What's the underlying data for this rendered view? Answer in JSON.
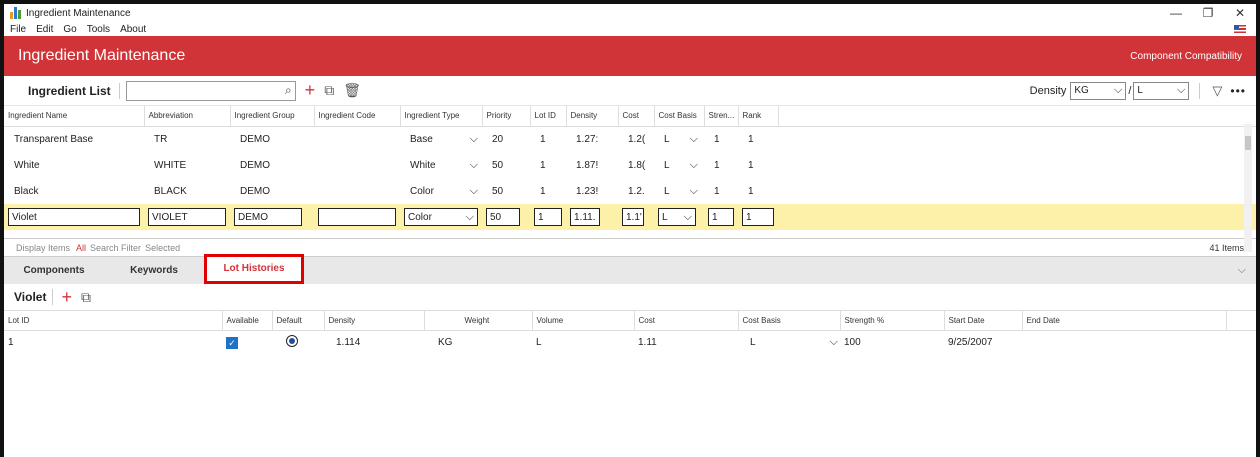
{
  "window": {
    "title": "Ingredient Maintenance",
    "controls": [
      "—",
      "❐",
      "✕"
    ]
  },
  "menu": [
    "File",
    "Edit",
    "Go",
    "Tools",
    "About"
  ],
  "banner": {
    "title": "Ingredient Maintenance",
    "link": "Component Compatibility",
    "color": "#d13438"
  },
  "toolbar": {
    "title": "Ingredient List",
    "search_value": "",
    "density_label": "Density",
    "density_unit1": "KG",
    "density_separator": "/",
    "density_unit2": "L"
  },
  "grid": {
    "columns": [
      "Ingredient Name",
      "Abbreviation",
      "Ingredient Group",
      "Ingredient Code",
      "Ingredient Type",
      "Priority",
      "Lot ID",
      "Density",
      "Cost",
      "Cost Basis",
      "Stren...",
      "Rank"
    ],
    "rows": [
      {
        "name": "Transparent Base",
        "abbr": "TR",
        "group": "DEMO",
        "code": "",
        "type": "Base",
        "priority": "20",
        "lot": "1",
        "density": "1.27:",
        "cost": "1.2(",
        "basis": "L",
        "strength": "1",
        "rank": "1"
      },
      {
        "name": "White",
        "abbr": "WHITE",
        "group": "DEMO",
        "code": "",
        "type": "White",
        "priority": "50",
        "lot": "1",
        "density": "1.87!",
        "cost": "1.8(",
        "basis": "L",
        "strength": "1",
        "rank": "1"
      },
      {
        "name": "Black",
        "abbr": "BLACK",
        "group": "DEMO",
        "code": "",
        "type": "Color",
        "priority": "50",
        "lot": "1",
        "density": "1.23!",
        "cost": "1.2.",
        "basis": "L",
        "strength": "1",
        "rank": "1"
      }
    ],
    "selected": {
      "name": "Violet",
      "abbr": "VIOLET",
      "group": "DEMO",
      "code": "",
      "type": "Color",
      "priority": "50",
      "lot": "1",
      "density": "1.11.",
      "cost": "1.1'",
      "basis": "L",
      "strength": "1",
      "rank": "1"
    }
  },
  "status": {
    "display_items": "Display Items",
    "all": "All",
    "search_filter": "Search Filter",
    "selected": "Selected",
    "count": "41 Items"
  },
  "tabs": [
    "Components",
    "Keywords",
    "Lot Histories"
  ],
  "active_tab": "Lot Histories",
  "lot_panel": {
    "title": "Violet",
    "columns": [
      "Lot ID",
      "Available",
      "Default",
      "Density",
      "Weight",
      "Volume",
      "Cost",
      "Cost Basis",
      "Strength %",
      "Start Date",
      "End Date"
    ],
    "rows": [
      {
        "lot": "1",
        "available": true,
        "default": true,
        "density": "1.114",
        "weight": "KG",
        "volume": "L",
        "cost": "1.11",
        "basis": "L",
        "strength": "100",
        "start": "9/25/2007",
        "end": ""
      }
    ]
  },
  "icons": {
    "search": "search-icon",
    "add": "add-icon",
    "copy": "copy-icon",
    "delete": "trash-icon",
    "filter": "filter-icon",
    "more": "more-icon"
  }
}
